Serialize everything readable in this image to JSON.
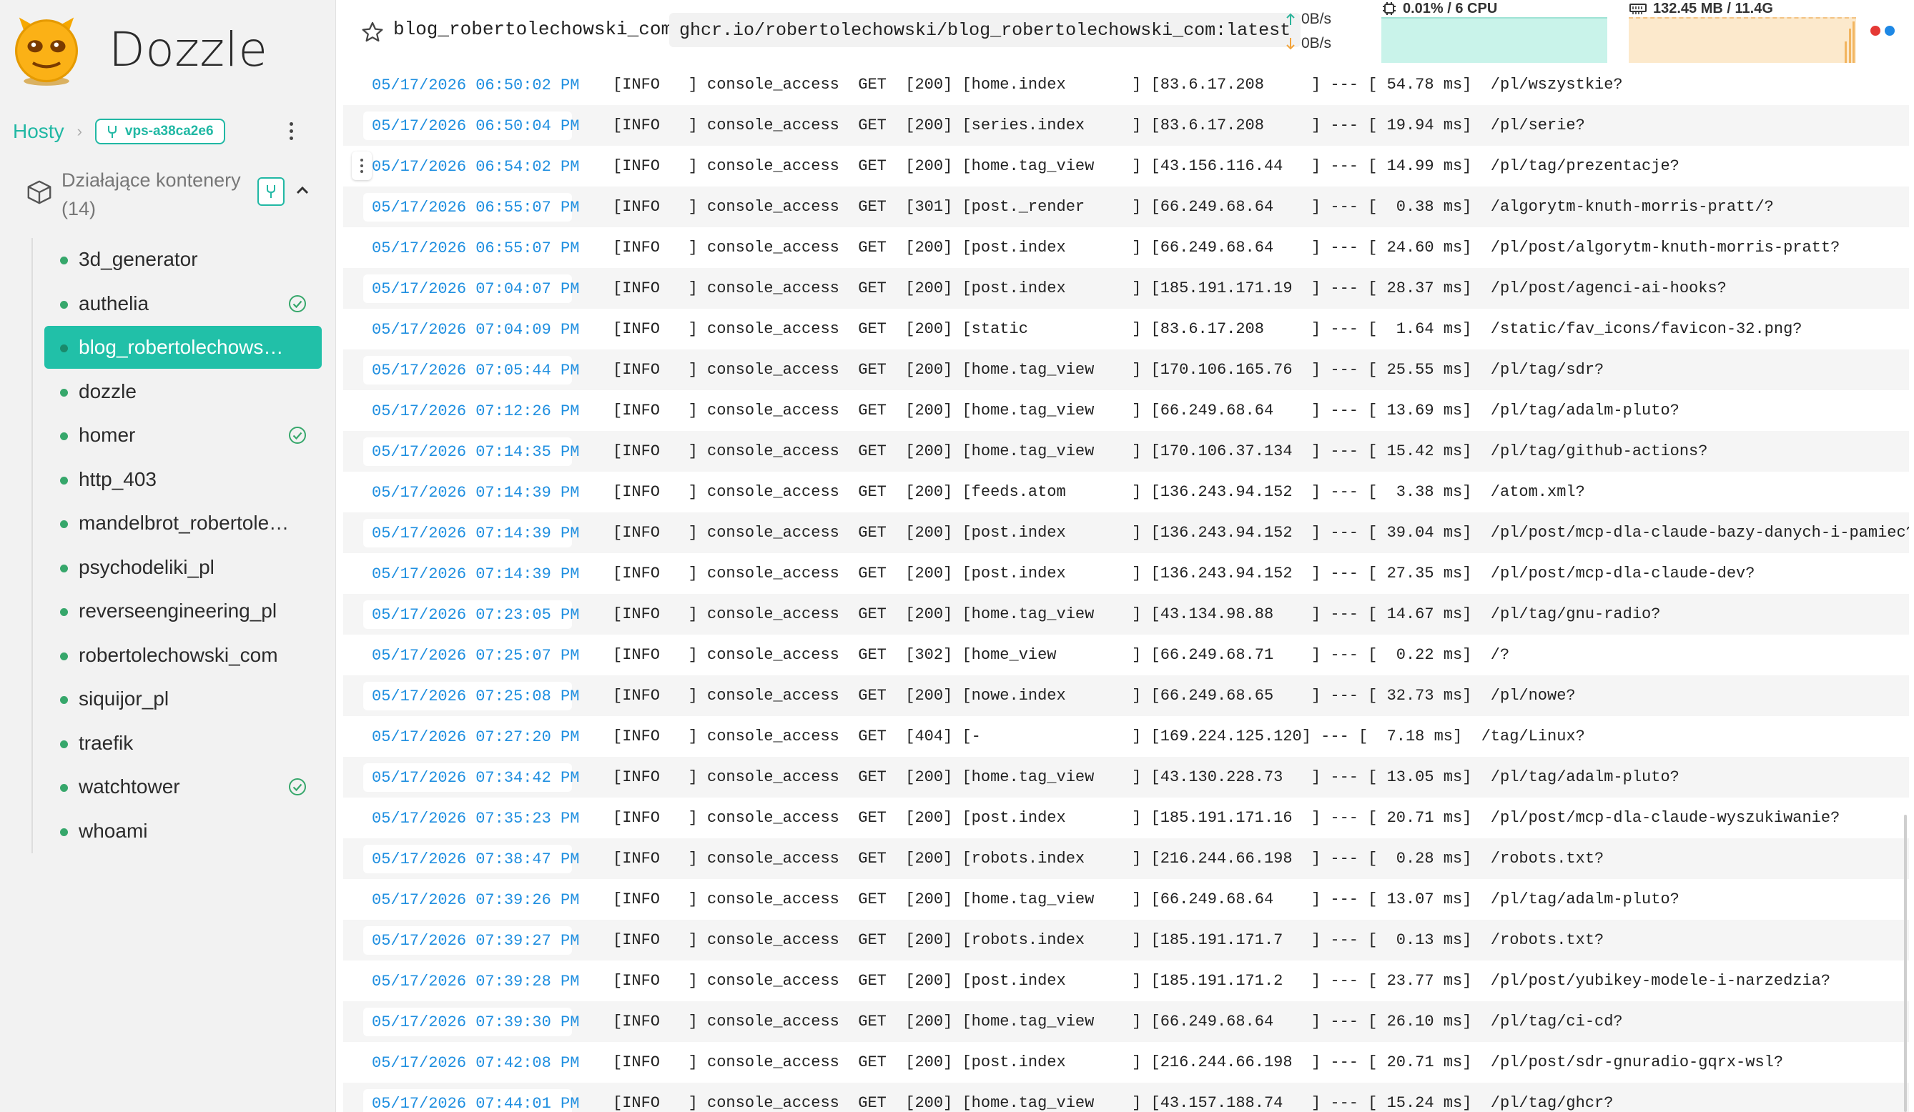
{
  "app": {
    "name": "Dozzle"
  },
  "sidebar": {
    "hosts_label": "Hosty",
    "host_badge": "vps-a38ca2e6",
    "section_title": "Działające kontenery (14)",
    "containers": [
      {
        "name": "3d_generator",
        "healthy": false,
        "active": false
      },
      {
        "name": "authelia",
        "healthy": true,
        "active": false
      },
      {
        "name": "blog_robertolechowski_c...",
        "healthy": false,
        "active": true
      },
      {
        "name": "dozzle",
        "healthy": false,
        "active": false
      },
      {
        "name": "homer",
        "healthy": true,
        "active": false
      },
      {
        "name": "http_403",
        "healthy": false,
        "active": false
      },
      {
        "name": "mandelbrot_robertolech...",
        "healthy": false,
        "active": false
      },
      {
        "name": "psychodeliki_pl",
        "healthy": false,
        "active": false
      },
      {
        "name": "reverseengineering_pl",
        "healthy": false,
        "active": false
      },
      {
        "name": "robertolechowski_com",
        "healthy": false,
        "active": false
      },
      {
        "name": "siquijor_pl",
        "healthy": false,
        "active": false
      },
      {
        "name": "traefik",
        "healthy": false,
        "active": false
      },
      {
        "name": "watchtower",
        "healthy": true,
        "active": false
      },
      {
        "name": "whoami",
        "healthy": false,
        "active": false
      }
    ]
  },
  "header": {
    "container_name": "blog_robertolechowski_com",
    "image": "ghcr.io/robertolechowski/blog_robertolechowski_com:latest",
    "net_up": "0B/s",
    "net_down": "0B/s",
    "cpu_label": "0.01% / 6 CPU",
    "mem_label": "132.45 MB / 11.4G",
    "colors": {
      "accent": "#21c0a8",
      "cpu_fill": "#c9f3ea",
      "mem_fill": "#fce9cc",
      "dot_red": "#e53935",
      "dot_blue": "#1e88e5"
    }
  },
  "logs": [
    {
      "ts": "05/17/2026 06:50:02 PM",
      "msg": "[INFO   ] console_access  GET  [200] [home.index       ] [83.6.17.208     ] --- [ 54.78 ms]  /pl/wszystkie?"
    },
    {
      "ts": "05/17/2026 06:50:04 PM",
      "msg": "[INFO   ] console_access  GET  [200] [series.index     ] [83.6.17.208     ] --- [ 19.94 ms]  /pl/serie?"
    },
    {
      "ts": "05/17/2026 06:54:02 PM",
      "msg": "[INFO   ] console_access  GET  [200] [home.tag_view    ] [43.156.116.44   ] --- [ 14.99 ms]  /pl/tag/prezentacje?"
    },
    {
      "ts": "05/17/2026 06:55:07 PM",
      "msg": "[INFO   ] console_access  GET  [301] [post._render     ] [66.249.68.64    ] --- [  0.38 ms]  /algorytm-knuth-morris-pratt/?"
    },
    {
      "ts": "05/17/2026 06:55:07 PM",
      "msg": "[INFO   ] console_access  GET  [200] [post.index       ] [66.249.68.64    ] --- [ 24.60 ms]  /pl/post/algorytm-knuth-morris-pratt?"
    },
    {
      "ts": "05/17/2026 07:04:07 PM",
      "msg": "[INFO   ] console_access  GET  [200] [post.index       ] [185.191.171.19  ] --- [ 28.37 ms]  /pl/post/agenci-ai-hooks?"
    },
    {
      "ts": "05/17/2026 07:04:09 PM",
      "msg": "[INFO   ] console_access  GET  [200] [static           ] [83.6.17.208     ] --- [  1.64 ms]  /static/fav_icons/favicon-32.png?"
    },
    {
      "ts": "05/17/2026 07:05:44 PM",
      "msg": "[INFO   ] console_access  GET  [200] [home.tag_view    ] [170.106.165.76  ] --- [ 25.55 ms]  /pl/tag/sdr?"
    },
    {
      "ts": "05/17/2026 07:12:26 PM",
      "msg": "[INFO   ] console_access  GET  [200] [home.tag_view    ] [66.249.68.64    ] --- [ 13.69 ms]  /pl/tag/adalm-pluto?"
    },
    {
      "ts": "05/17/2026 07:14:35 PM",
      "msg": "[INFO   ] console_access  GET  [200] [home.tag_view    ] [170.106.37.134  ] --- [ 15.42 ms]  /pl/tag/github-actions?"
    },
    {
      "ts": "05/17/2026 07:14:39 PM",
      "msg": "[INFO   ] console_access  GET  [200] [feeds.atom       ] [136.243.94.152  ] --- [  3.38 ms]  /atom.xml?"
    },
    {
      "ts": "05/17/2026 07:14:39 PM",
      "msg": "[INFO   ] console_access  GET  [200] [post.index       ] [136.243.94.152  ] --- [ 39.04 ms]  /pl/post/mcp-dla-claude-bazy-danych-i-pamiec?"
    },
    {
      "ts": "05/17/2026 07:14:39 PM",
      "msg": "[INFO   ] console_access  GET  [200] [post.index       ] [136.243.94.152  ] --- [ 27.35 ms]  /pl/post/mcp-dla-claude-dev?"
    },
    {
      "ts": "05/17/2026 07:23:05 PM",
      "msg": "[INFO   ] console_access  GET  [200] [home.tag_view    ] [43.134.98.88    ] --- [ 14.67 ms]  /pl/tag/gnu-radio?"
    },
    {
      "ts": "05/17/2026 07:25:07 PM",
      "msg": "[INFO   ] console_access  GET  [302] [home_view        ] [66.249.68.71    ] --- [  0.22 ms]  /?"
    },
    {
      "ts": "05/17/2026 07:25:08 PM",
      "msg": "[INFO   ] console_access  GET  [200] [nowe.index       ] [66.249.68.65    ] --- [ 32.73 ms]  /pl/nowe?"
    },
    {
      "ts": "05/17/2026 07:27:20 PM",
      "msg": "[INFO   ] console_access  GET  [404] [-                ] [169.224.125.120] --- [  7.18 ms]  /tag/Linux?"
    },
    {
      "ts": "05/17/2026 07:34:42 PM",
      "msg": "[INFO   ] console_access  GET  [200] [home.tag_view    ] [43.130.228.73   ] --- [ 13.05 ms]  /pl/tag/adalm-pluto?"
    },
    {
      "ts": "05/17/2026 07:35:23 PM",
      "msg": "[INFO   ] console_access  GET  [200] [post.index       ] [185.191.171.16  ] --- [ 20.71 ms]  /pl/post/mcp-dla-claude-wyszukiwanie?"
    },
    {
      "ts": "05/17/2026 07:38:47 PM",
      "msg": "[INFO   ] console_access  GET  [200] [robots.index     ] [216.244.66.198  ] --- [  0.28 ms]  /robots.txt?"
    },
    {
      "ts": "05/17/2026 07:39:26 PM",
      "msg": "[INFO   ] console_access  GET  [200] [home.tag_view    ] [66.249.68.64    ] --- [ 13.07 ms]  /pl/tag/adalm-pluto?"
    },
    {
      "ts": "05/17/2026 07:39:27 PM",
      "msg": "[INFO   ] console_access  GET  [200] [robots.index     ] [185.191.171.7   ] --- [  0.13 ms]  /robots.txt?"
    },
    {
      "ts": "05/17/2026 07:39:28 PM",
      "msg": "[INFO   ] console_access  GET  [200] [post.index       ] [185.191.171.2   ] --- [ 23.77 ms]  /pl/post/yubikey-modele-i-narzedzia?"
    },
    {
      "ts": "05/17/2026 07:39:30 PM",
      "msg": "[INFO   ] console_access  GET  [200] [home.tag_view    ] [66.249.68.64    ] --- [ 26.10 ms]  /pl/tag/ci-cd?"
    },
    {
      "ts": "05/17/2026 07:42:08 PM",
      "msg": "[INFO   ] console_access  GET  [200] [post.index       ] [216.244.66.198  ] --- [ 20.71 ms]  /pl/post/sdr-gnuradio-gqrx-wsl?"
    },
    {
      "ts": "05/17/2026 07:44:01 PM",
      "msg": "[INFO   ] console_access  GET  [200] [home.tag_view    ] [43.157.188.74   ] --- [ 15.24 ms]  /pl/tag/ghcr?"
    }
  ]
}
